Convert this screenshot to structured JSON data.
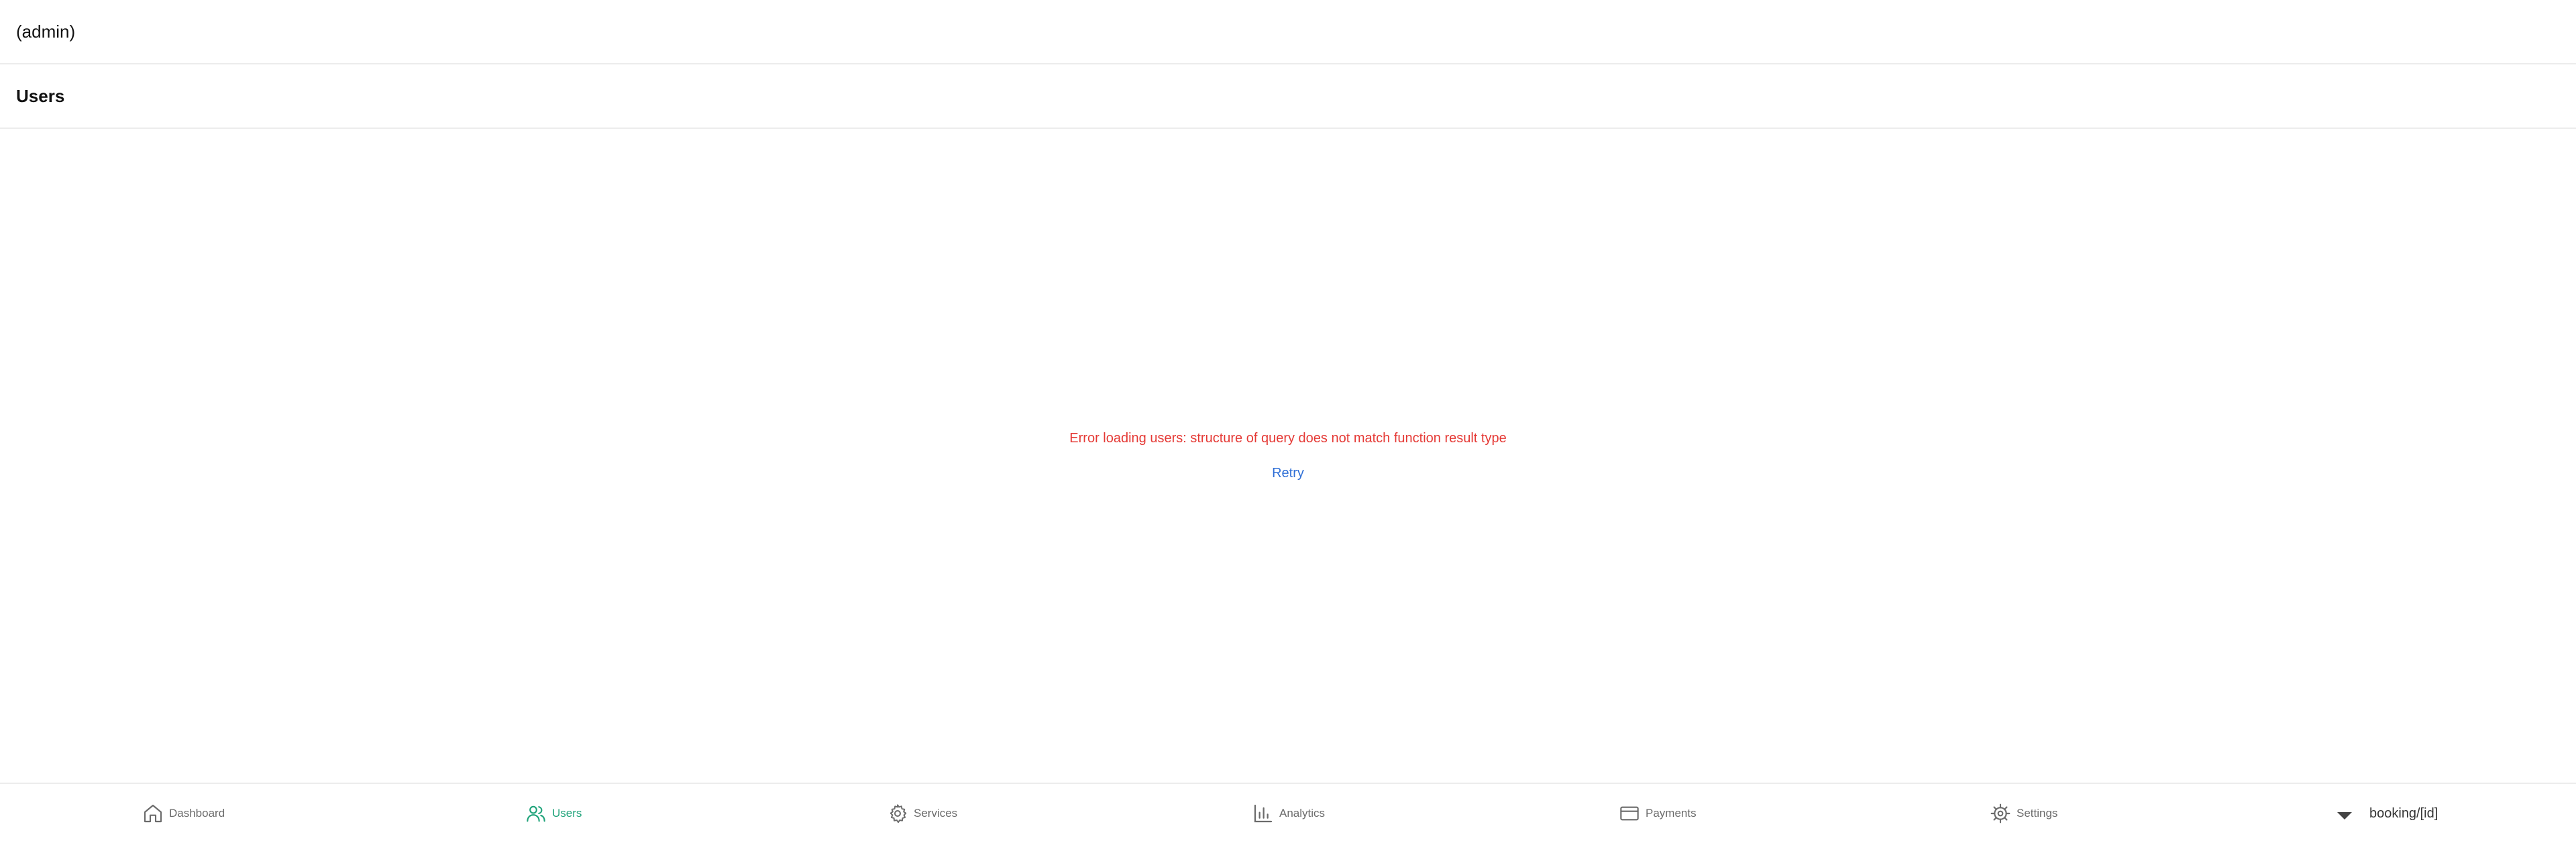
{
  "header": {
    "app_title": "(admin)"
  },
  "page": {
    "title": "Users"
  },
  "error": {
    "message": "Error loading users: structure of query does not match function result type",
    "retry_label": "Retry"
  },
  "tabs": [
    {
      "label": "Dashboard",
      "icon": "home-icon",
      "active": false
    },
    {
      "label": "Users",
      "icon": "users-icon",
      "active": true
    },
    {
      "label": "Services",
      "icon": "gear-icon",
      "active": false
    },
    {
      "label": "Analytics",
      "icon": "bar-chart-icon",
      "active": false
    },
    {
      "label": "Payments",
      "icon": "credit-card-icon",
      "active": false
    },
    {
      "label": "Settings",
      "icon": "settings-icon",
      "active": false
    }
  ],
  "more_tab": {
    "label": "booking/[id]",
    "icon": "caret-down-icon"
  },
  "colors": {
    "accent": "#1fa37a",
    "error": "#e53935",
    "link": "#2f6fd6",
    "inactive": "#6b6b6b"
  }
}
